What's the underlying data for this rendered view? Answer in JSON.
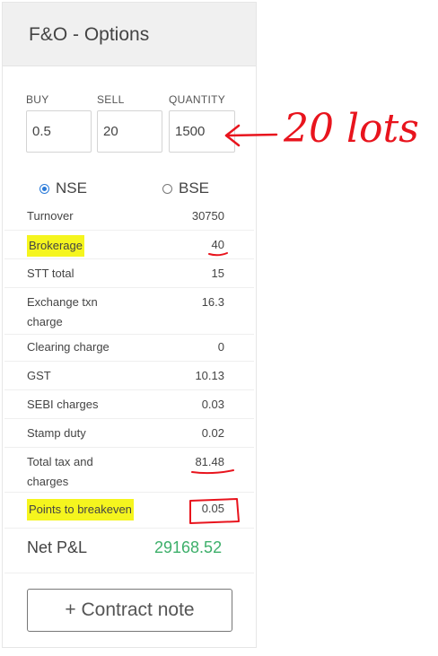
{
  "header": {
    "title": "F&O - Options"
  },
  "inputs": {
    "buy": {
      "label": "BUY",
      "value": "0.5"
    },
    "sell": {
      "label": "SELL",
      "value": "20"
    },
    "quantity": {
      "label": "QUANTITY",
      "value": "1500"
    }
  },
  "exchanges": [
    {
      "label": "NSE",
      "selected": true
    },
    {
      "label": "BSE",
      "selected": false
    }
  ],
  "rows": [
    {
      "label": "Turnover",
      "value": "30750"
    },
    {
      "label": "Brokerage",
      "value": "40"
    },
    {
      "label": "STT total",
      "value": "15"
    },
    {
      "label": "Exchange txn",
      "label2": "charge",
      "value": "16.3"
    },
    {
      "label": "Clearing charge",
      "value": "0"
    },
    {
      "label": "GST",
      "value": "10.13"
    },
    {
      "label": "SEBI charges",
      "value": "0.03"
    },
    {
      "label": "Stamp duty",
      "value": "0.02"
    },
    {
      "label": "Total tax and",
      "label2": "charges",
      "value": "81.48"
    },
    {
      "label": "Points to breakeven",
      "value": "0.05"
    }
  ],
  "net_pl": {
    "label": "Net P&L",
    "value": "29168.52"
  },
  "contract_note_label": "+ Contract note",
  "annotation": {
    "text": "20 lots",
    "color": "#e8141d"
  },
  "colors": {
    "highlight": "#f5f51e",
    "profit": "#3daf6a",
    "accent": "#2b7bd9"
  }
}
